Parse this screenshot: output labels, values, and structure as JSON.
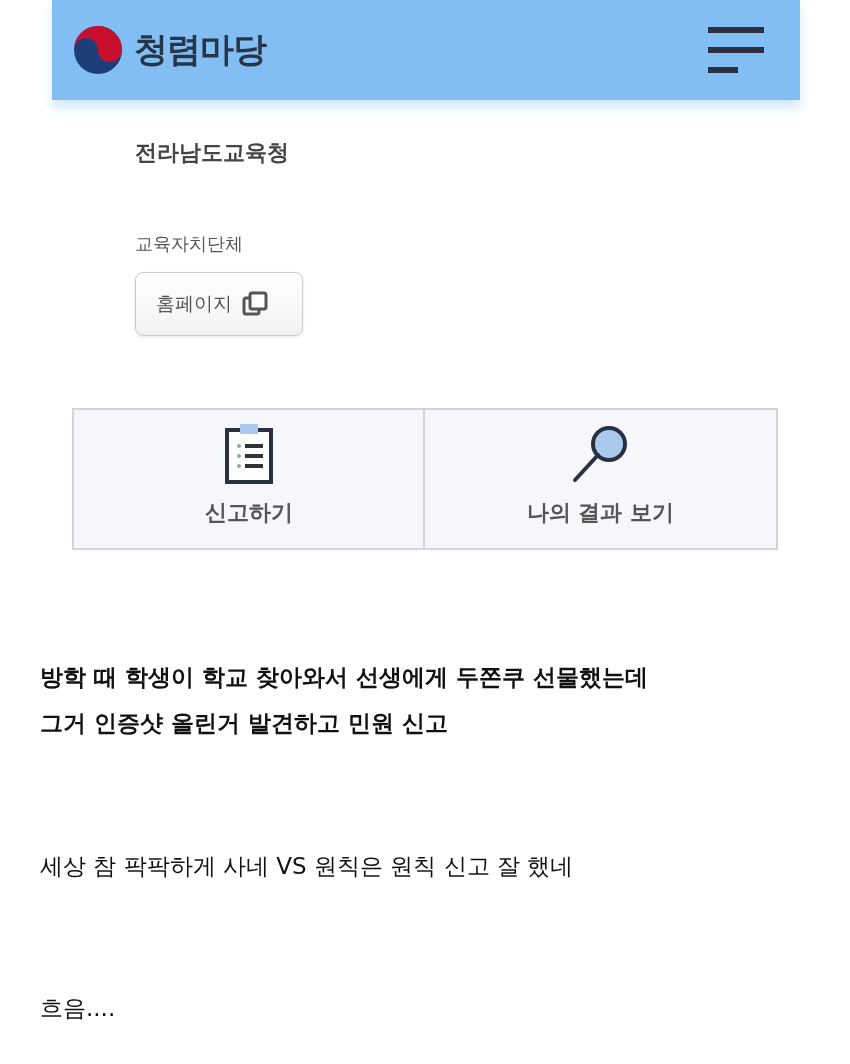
{
  "header": {
    "title": "청렴마당"
  },
  "organization": {
    "name": "전라남도교육청",
    "category": "교육자치단체",
    "homepage_button": "홈페이지"
  },
  "actions": [
    {
      "kind": "report",
      "label": "신고하기"
    },
    {
      "kind": "results",
      "label": "나의 결과 보기"
    }
  ],
  "post": {
    "headline_lines": [
      "방학 때 학생이 학교 찾아와서 선생에게 두쫀쿠 선물했는데",
      "그거 인증샷 올린거 발견하고 민원 신고"
    ],
    "paragraphs": [
      "세상 참 팍팍하게 사네 VS 원칙은 원칙 신고 잘 했네",
      "흐음...."
    ]
  }
}
